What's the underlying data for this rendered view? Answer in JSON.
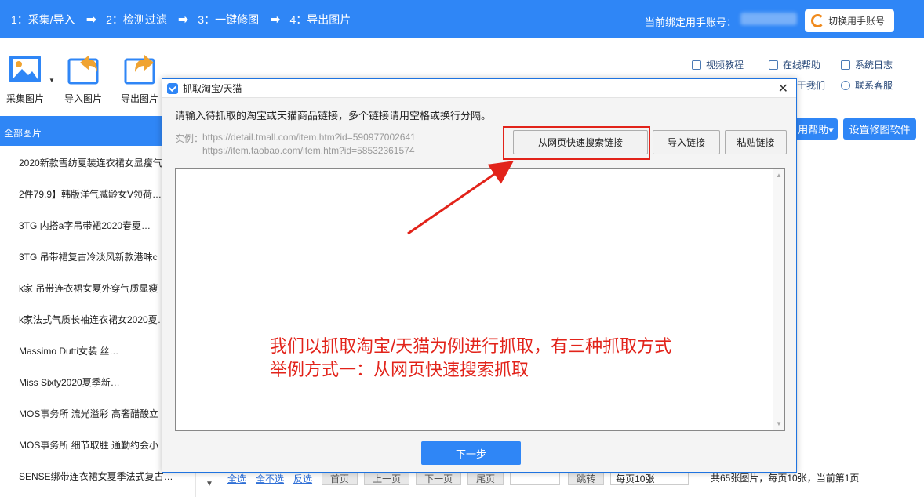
{
  "topbar": {
    "steps": [
      "1：采集/导入",
      "2：检测过滤",
      "3：一键修图",
      "4：导出图片"
    ],
    "bound_label": "当前绑定用手账号：",
    "switch_button": "切换用手账号"
  },
  "toolbar": {
    "collect": "采集图片",
    "import": "导入图片",
    "export": "导出图片"
  },
  "help": {
    "video": "视频教程",
    "online": "在线帮助",
    "log": "系统日志",
    "about": "于我们",
    "service": "联系客服"
  },
  "right_buttons": {
    "help_menu": "用帮助▾",
    "settings": "设置修图软件"
  },
  "sidebar": {
    "header": "全部图片",
    "items": [
      "2020新款雪纺夏装连衣裙女显瘦气",
      "2件79.9】韩版洋气减龄女V领荷…",
      "3TG 内搭a字吊带裙2020春夏…",
      "3TG 吊带裙复古冷淡风新款港味c",
      "k家 吊带连衣裙女夏外穿气质显瘦",
      "k家法式气质长袖连衣裙女2020夏…",
      "Massimo Dutti女装 丝…",
      "Miss Sixty2020夏季新…",
      "MOS事务所 流光溢彩 高奢醋酸立",
      "MOS事务所 细节取胜 通勤约会小",
      "SENSE绑带连衣裙女夏季法式复古…"
    ]
  },
  "pager": {
    "select_all": "全选",
    "select_none": "全不选",
    "invert": "反选",
    "first": "首页",
    "prev": "上一页",
    "next": "下一页",
    "last": "尾页",
    "jump": "跳转",
    "per_page": "每页10张",
    "info": "共65张图片，每页10张，当前第1页"
  },
  "dialog": {
    "title": "抓取淘宝/天猫",
    "instruction": "请输入待抓取的淘宝或天猫商品链接，多个链接请用空格或换行分隔。",
    "example_label": "实例：",
    "example_url_1": "https://detail.tmall.com/item.htm?id=590977002641",
    "example_url_2": "https://item.taobao.com/item.htm?id=58532361574",
    "btn_quick_search": "从网页快速搜索链接",
    "btn_import": "导入链接",
    "btn_paste": "粘贴链接",
    "btn_next": "下一步"
  },
  "annotation": {
    "line1": "我们以抓取淘宝/天猫为例进行抓取，有三种抓取方式",
    "line2": "举例方式一：从网页快速搜索抓取"
  },
  "colors": {
    "brand_blue": "#2f86f6",
    "annotation_red": "#e2231a"
  }
}
